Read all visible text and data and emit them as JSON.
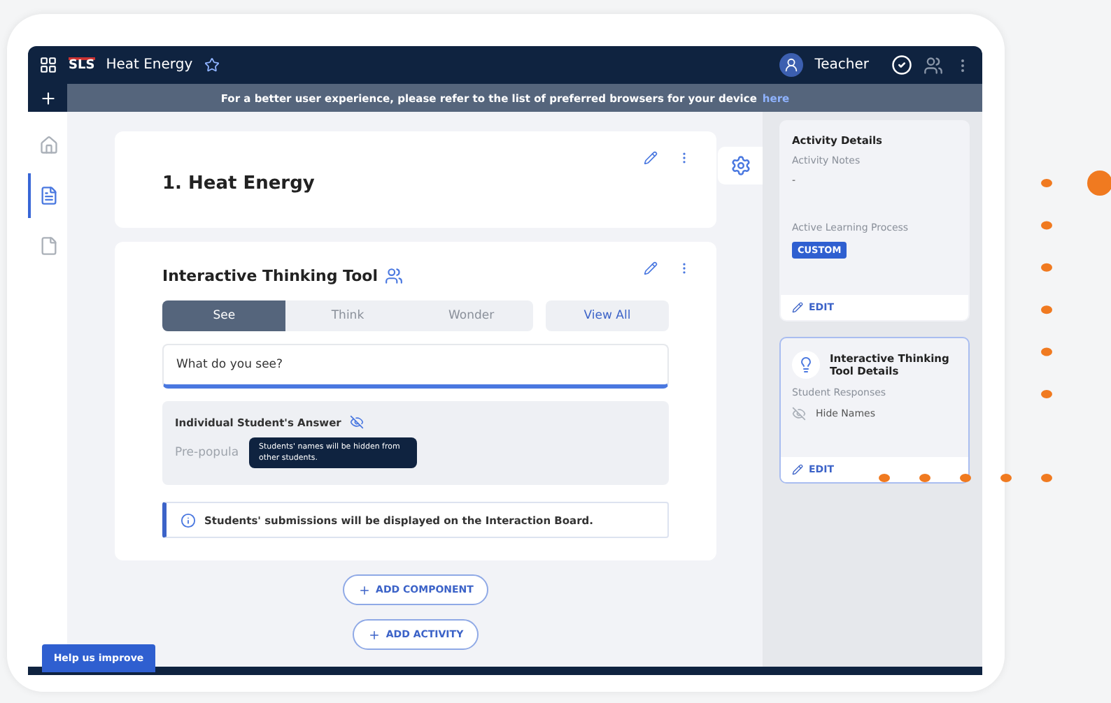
{
  "topbar": {
    "logo": "SLS",
    "title": "Heat Energy",
    "role": "Teacher"
  },
  "banner": {
    "text": "For a better user experience, please refer to the list of preferred browsers for your device",
    "link": "here"
  },
  "rail": [
    {
      "kind": "home",
      "selected": false
    },
    {
      "kind": "page",
      "selected": true
    },
    {
      "kind": "doc",
      "selected": false
    }
  ],
  "activity": {
    "title": "1. Heat Energy"
  },
  "tool": {
    "title": "Interactive Thinking Tool",
    "tabs": [
      {
        "label": "See",
        "selected": true
      },
      {
        "label": "Think",
        "selected": false
      },
      {
        "label": "Wonder",
        "selected": false
      }
    ],
    "view_all": "View All",
    "question": "What do you see?",
    "answer_title": "Individual Student's Answer",
    "placeholder": "Pre-popula",
    "tooltip": "Students' names will be hidden from other students.",
    "info": "Students' submissions will be displayed on the Interaction Board."
  },
  "actions": [
    "ADD COMPONENT",
    "ADD ACTIVITY"
  ],
  "details": {
    "title": "Activity Details",
    "notes_label": "Activity Notes",
    "notes": "-",
    "process_label": "Active Learning Process",
    "process": "CUSTOM",
    "edit": "EDIT"
  },
  "tool_details": {
    "title": "Interactive Thinking Tool Details",
    "responses_label": "Student Responses",
    "responses": "Hide Names",
    "edit": "EDIT"
  },
  "help": "Help us improve"
}
